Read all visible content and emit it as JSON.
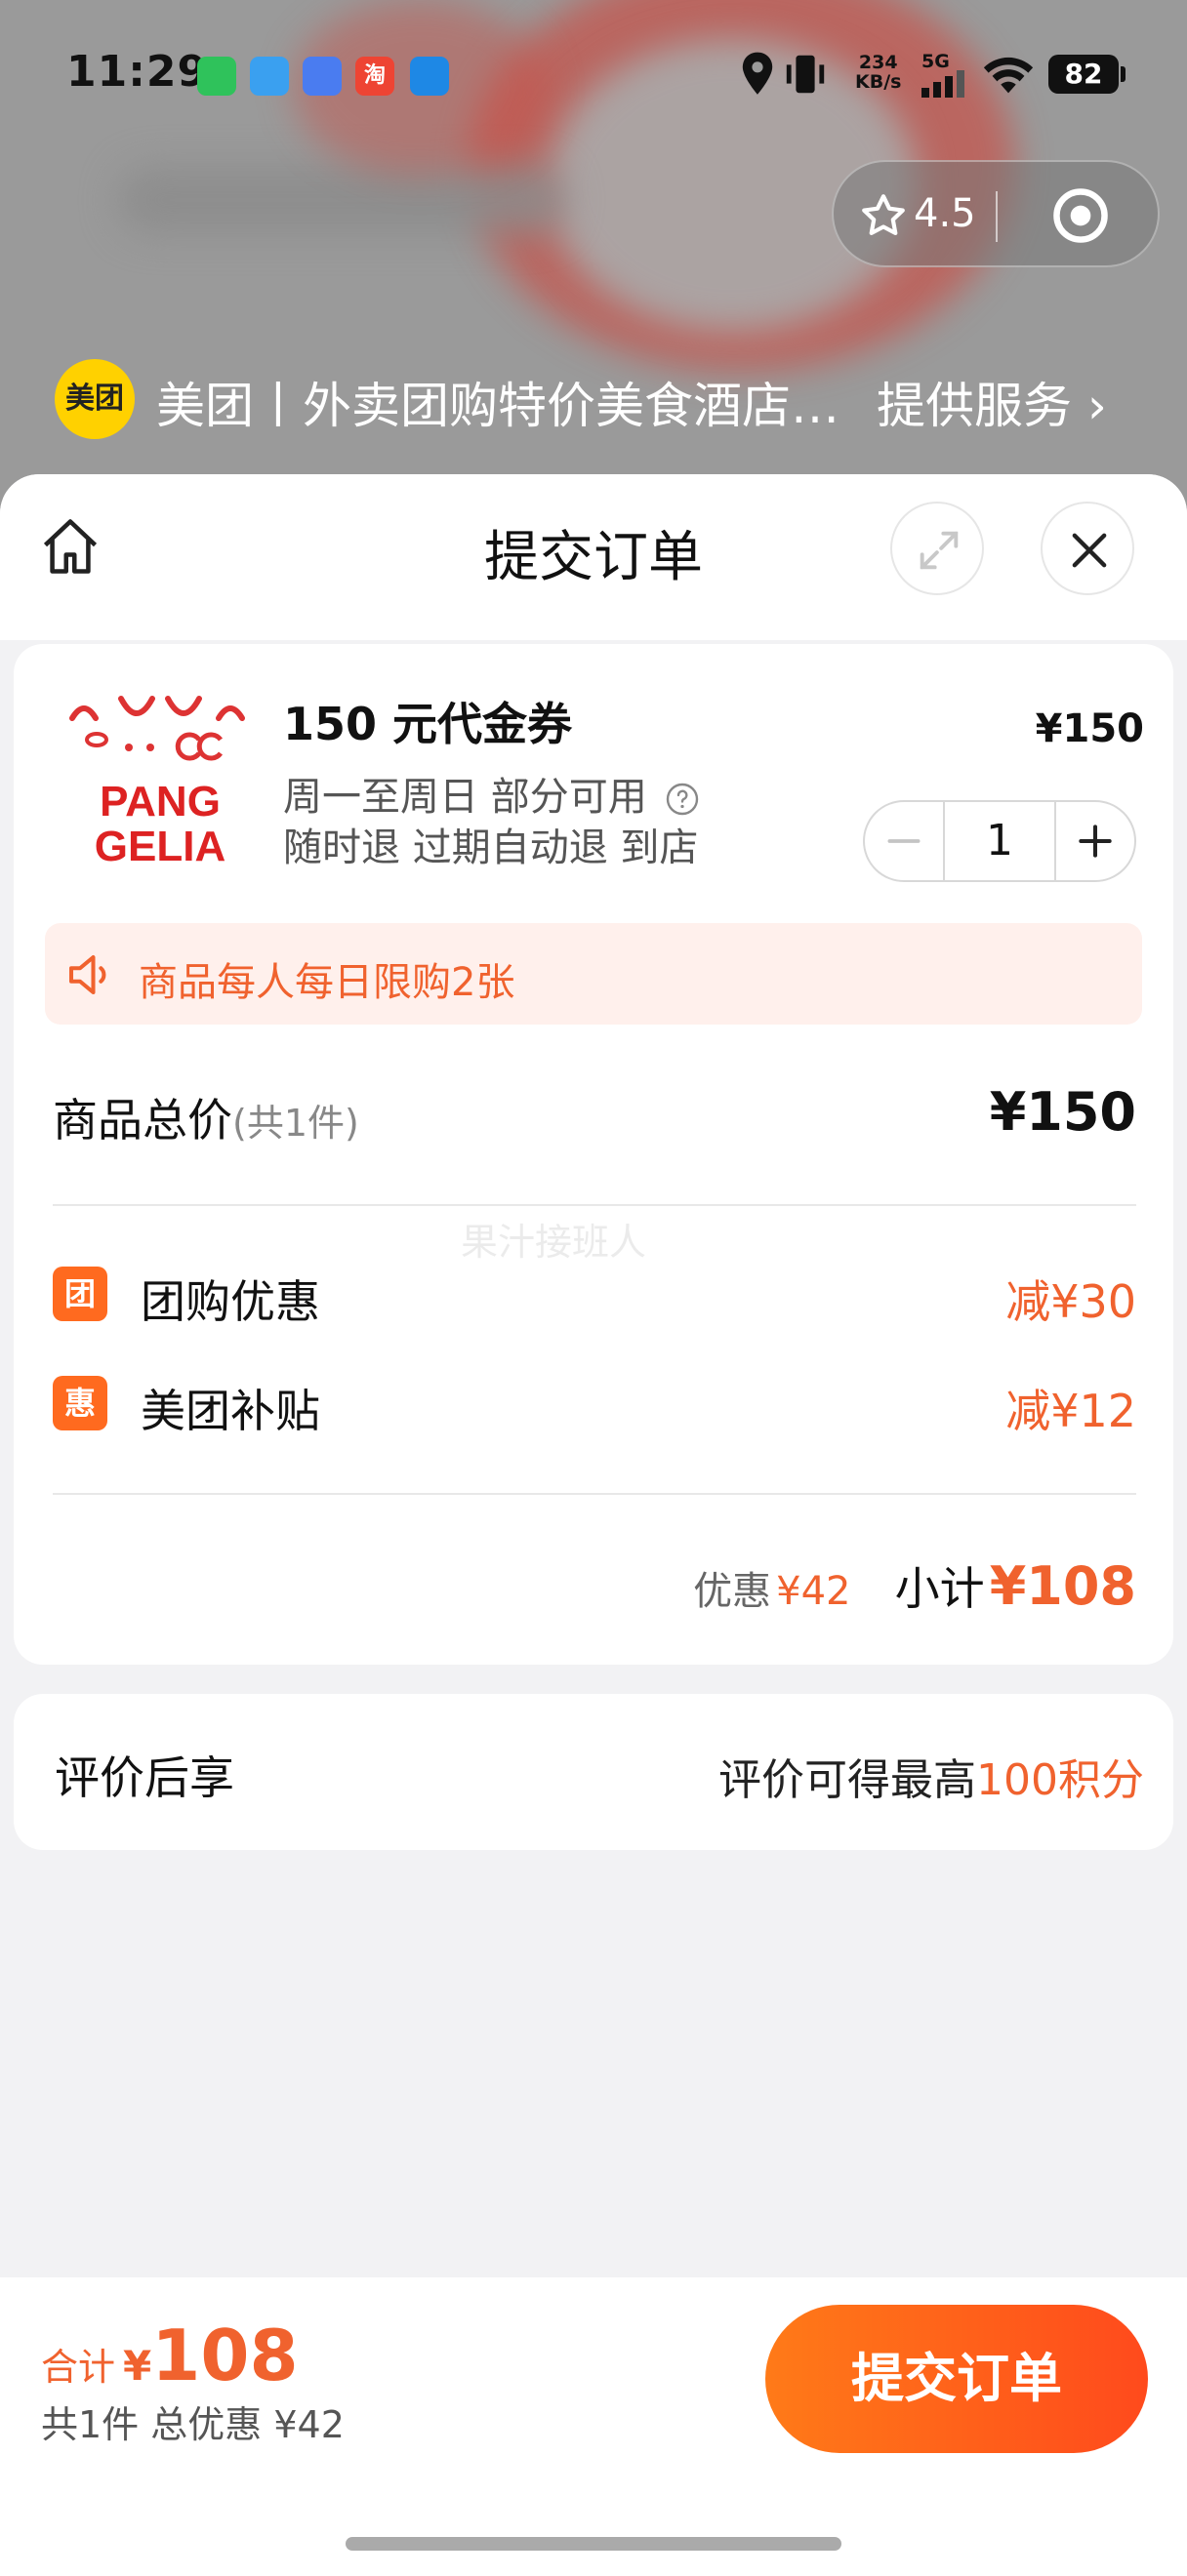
{
  "status_bar": {
    "time": "11:29",
    "speed_value": "234",
    "speed_unit": "KB/s",
    "network": "5G",
    "battery": "82",
    "notification_badge": "淘"
  },
  "capsule": {
    "rating": "4.5"
  },
  "merchant": {
    "logo_text": "美团",
    "title": "美团丨外卖团购特价美食酒店电影",
    "service_link": "提供服务"
  },
  "sheet": {
    "title": "提交订单",
    "home_icon": "home-icon",
    "expand_icon": "expand-icon",
    "close_icon": "close-icon"
  },
  "product": {
    "image_text_line1": "PANG",
    "image_text_line2": "GELIA",
    "name": "150 元代金券",
    "price": "¥150",
    "usage": "周一至周日 部分可用",
    "refund": "随时退 过期自动退 到店",
    "quantity": "1"
  },
  "limit_notice": "商品每人每日限购2张",
  "totals": {
    "label": "商品总价",
    "count": "(共1件)",
    "value": "¥150"
  },
  "watermark": "果汁接班人",
  "discounts": [
    {
      "badge": "团",
      "label": "团购优惠",
      "value": "减¥30"
    },
    {
      "badge": "惠",
      "label": "美团补贴",
      "value": "减¥12"
    }
  ],
  "subtotal": {
    "discount_label": "优惠",
    "discount_value": "¥42",
    "label": "小计",
    "value": "¥108"
  },
  "review": {
    "label": "评价后享",
    "value_prefix": "评价可得最高",
    "value_accent": "100积分"
  },
  "bottom_bar": {
    "total_label": "合计",
    "currency": "¥",
    "amount": "108",
    "summary": "共1件 总优惠 ¥42",
    "submit_label": "提交订单"
  },
  "colors": {
    "accent": "#f0622e",
    "button_start": "#ff7a18",
    "button_end": "#ff4a1c",
    "meituan_yellow": "#ffd100"
  }
}
